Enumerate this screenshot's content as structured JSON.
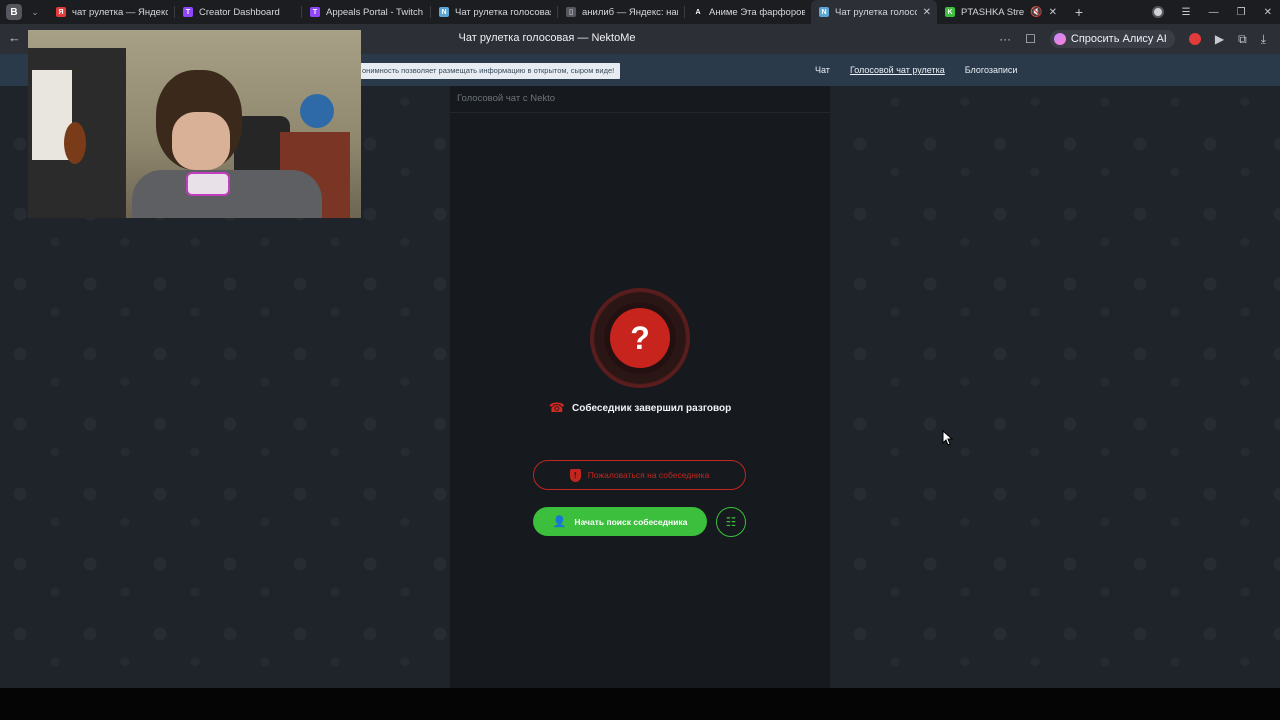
{
  "browser": {
    "logo_text": "B",
    "tabs": [
      {
        "title": "чат рулетка — Яндекс: н",
        "favicon": "Я",
        "favicon_color": "#e23b3b",
        "active": false
      },
      {
        "title": "Creator Dashboard",
        "favicon": "T",
        "favicon_color": "#9146ff",
        "active": false
      },
      {
        "title": "Appeals Portal - Twitch",
        "favicon": "T",
        "favicon_color": "#9146ff",
        "active": false
      },
      {
        "title": "Чат рулетка голосовая",
        "favicon": "N",
        "favicon_color": "#5aa7d6",
        "active": false
      },
      {
        "title": "анилиб — Яндекс: нашл",
        "favicon": "▯",
        "favicon_color": "#55575e",
        "active": false
      },
      {
        "title": "Аниме Эта фарфорова",
        "favicon": "A",
        "favicon_color": "#1c1d21",
        "active": false
      },
      {
        "title": "Чат рулетка голосова",
        "favicon": "N",
        "favicon_color": "#5aa7d6",
        "active": true
      },
      {
        "title": "PTASHKA Stream",
        "favicon": "K",
        "favicon_color": "#3bbf3c",
        "active": false
      }
    ],
    "page_title": "Чат рулетка голосовая — NektoMe",
    "alice_label": "Спросить Алису AI"
  },
  "site": {
    "notice": "онимность позволяет размещать информацию в открытом, сыром виде!",
    "nav": [
      {
        "label": "Чат",
        "current": false
      },
      {
        "label": "Голосовой чат рулетка",
        "current": true
      },
      {
        "label": "Блогозаписи",
        "current": false
      }
    ],
    "panel_title": "Голосовой чат с Nekto",
    "status_icon": "question-mark",
    "status_text": "Собеседник завершил разговор",
    "report_label": "Пожаловаться на собеседника",
    "search_label": "Начать поиск собеседника",
    "colors": {
      "accent_green": "#3bbf3c",
      "danger_red": "#c2271f"
    }
  }
}
